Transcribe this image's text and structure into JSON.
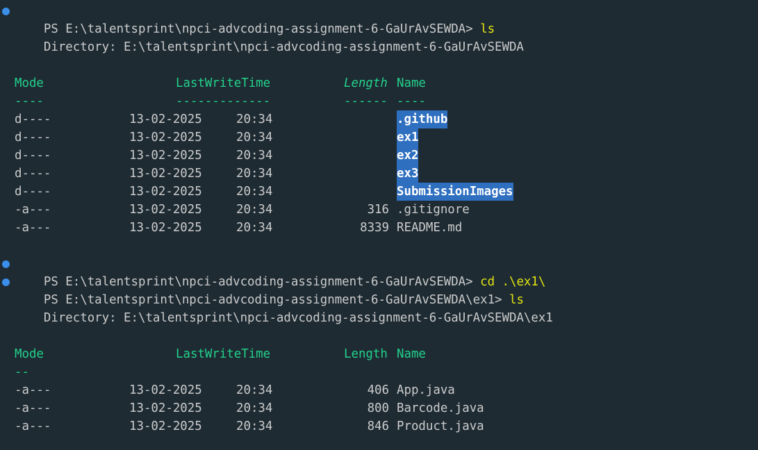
{
  "theme": {
    "background": "#1e2b33",
    "text": "#cccccc",
    "command": "#e5e510",
    "header": "#23d18b",
    "highlight": "#2f6fbf",
    "prompt_dot": "#3b8eea"
  },
  "prompts": [
    {
      "prompt": "PS E:\\talentsprint\\npci-advcoding-assignment-6-GaUrAvSEWDA> ",
      "command": "ls"
    },
    {
      "prompt": "PS E:\\talentsprint\\npci-advcoding-assignment-6-GaUrAvSEWDA> ",
      "command": "cd .\\ex1\\"
    },
    {
      "prompt": "PS E:\\talentsprint\\npci-advcoding-assignment-6-GaUrAvSEWDA\\ex1> ",
      "command": "ls"
    }
  ],
  "listings": [
    {
      "directory": "    Directory: E:\\talentsprint\\npci-advcoding-assignment-6-GaUrAvSEWDA",
      "headers": {
        "mode": "Mode",
        "lastwrite": "LastWriteTime",
        "length": "Length",
        "name": "Name"
      },
      "separators": {
        "mode": "----",
        "lastwrite": "-------------",
        "length": "------",
        "name": "----"
      },
      "rows": [
        {
          "mode": "d----",
          "date": "13-02-2025",
          "time": "20:34",
          "length": "",
          "name": ".github"
        },
        {
          "mode": "d----",
          "date": "13-02-2025",
          "time": "20:34",
          "length": "",
          "name": "ex1"
        },
        {
          "mode": "d----",
          "date": "13-02-2025",
          "time": "20:34",
          "length": "",
          "name": "ex2"
        },
        {
          "mode": "d----",
          "date": "13-02-2025",
          "time": "20:34",
          "length": "",
          "name": "ex3"
        },
        {
          "mode": "d----",
          "date": "13-02-2025",
          "time": "20:34",
          "length": "",
          "name": "SubmissionImages"
        },
        {
          "mode": "-a---",
          "date": "13-02-2025",
          "time": "20:34",
          "length": "316",
          "name": ".gitignore"
        },
        {
          "mode": "-a---",
          "date": "13-02-2025",
          "time": "20:34",
          "length": "8339",
          "name": "README.md"
        }
      ]
    },
    {
      "directory": "    Directory: E:\\talentsprint\\npci-advcoding-assignment-6-GaUrAvSEWDA\\ex1",
      "headers": {
        "mode": "Mode",
        "lastwrite": "LastWriteTime",
        "length": "Length",
        "name": "Name"
      },
      "separators": {
        "mode": "--"
      },
      "rows": [
        {
          "mode": "-a---",
          "date": "13-02-2025",
          "time": "20:34",
          "length": "406",
          "name": "App.java"
        },
        {
          "mode": "-a---",
          "date": "13-02-2025",
          "time": "20:34",
          "length": "800",
          "name": "Barcode.java"
        },
        {
          "mode": "-a---",
          "date": "13-02-2025",
          "time": "20:34",
          "length": "846",
          "name": "Product.java"
        }
      ]
    }
  ]
}
